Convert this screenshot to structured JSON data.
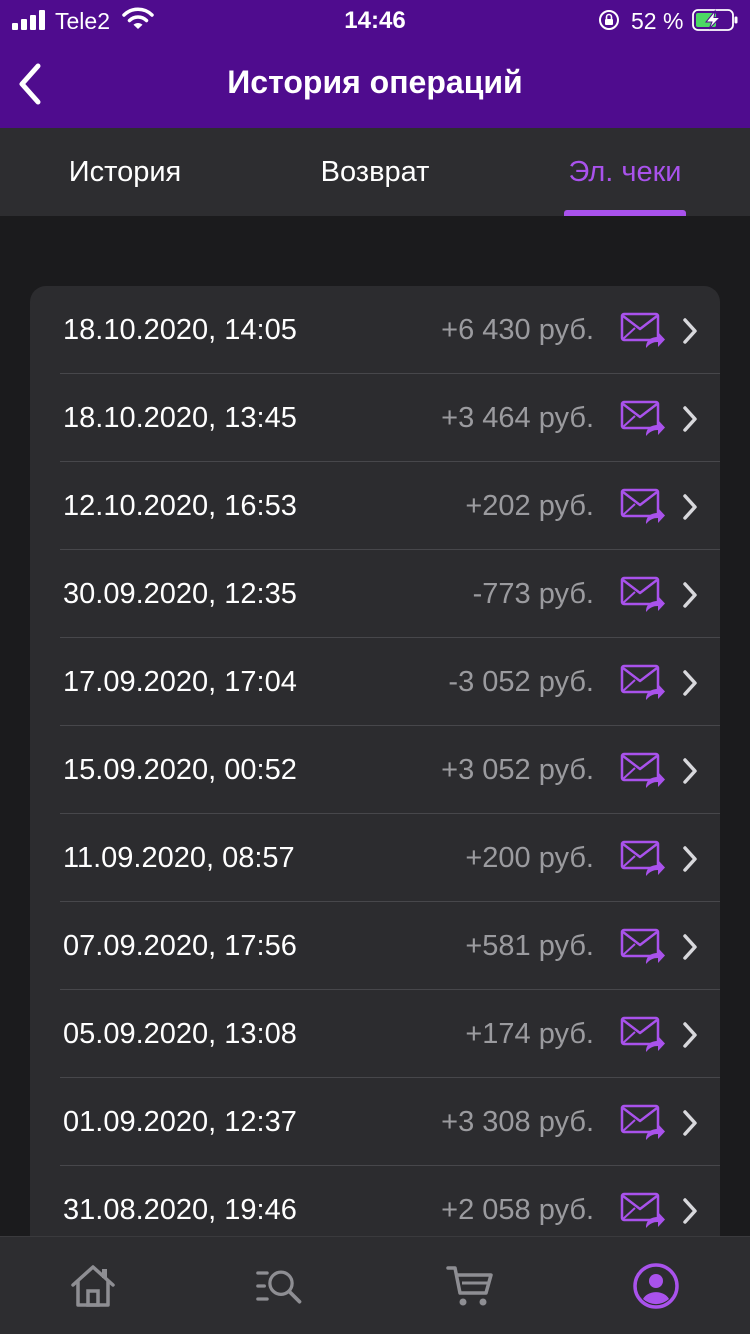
{
  "status_bar": {
    "carrier": "Tele2",
    "time": "14:46",
    "battery_percent": "52 %",
    "icons": [
      "signal-icon",
      "wifi-icon",
      "orientation-lock-icon",
      "battery-charging-icon"
    ]
  },
  "header": {
    "title": "История операций",
    "back_icon": "chevron-left-icon"
  },
  "tabs": [
    {
      "label": "История",
      "active": false
    },
    {
      "label": "Возврат",
      "active": false
    },
    {
      "label": "Эл. чеки",
      "active": true
    }
  ],
  "operations": [
    {
      "date": "18.10.2020, 14:05",
      "amount": "+6 430 руб."
    },
    {
      "date": "18.10.2020, 13:45",
      "amount": "+3 464 руб."
    },
    {
      "date": "12.10.2020, 16:53",
      "amount": "+202 руб."
    },
    {
      "date": "30.09.2020, 12:35",
      "amount": "-773 руб."
    },
    {
      "date": "17.09.2020, 17:04",
      "amount": "-3 052 руб."
    },
    {
      "date": "15.09.2020, 00:52",
      "amount": "+3 052 руб."
    },
    {
      "date": "11.09.2020, 08:57",
      "amount": "+200 руб."
    },
    {
      "date": "07.09.2020, 17:56",
      "amount": "+581 руб."
    },
    {
      "date": "05.09.2020, 13:08",
      "amount": "+174 руб."
    },
    {
      "date": "01.09.2020, 12:37",
      "amount": "+3 308 руб."
    },
    {
      "date": "31.08.2020, 19:46",
      "amount": "+2 058 руб."
    }
  ],
  "row_icons": {
    "send": "mail-forward-icon",
    "open": "chevron-right-icon"
  },
  "tab_bar": [
    {
      "icon": "home-icon",
      "active": false
    },
    {
      "icon": "search-list-icon",
      "active": false
    },
    {
      "icon": "cart-icon",
      "active": false
    },
    {
      "icon": "profile-icon",
      "active": true
    }
  ],
  "colors": {
    "header_bg": "#4f0c8e",
    "accent": "#a952ec",
    "background": "#1b1b1d",
    "card": "#2c2c2f",
    "amount_text": "#9b9b9f"
  }
}
